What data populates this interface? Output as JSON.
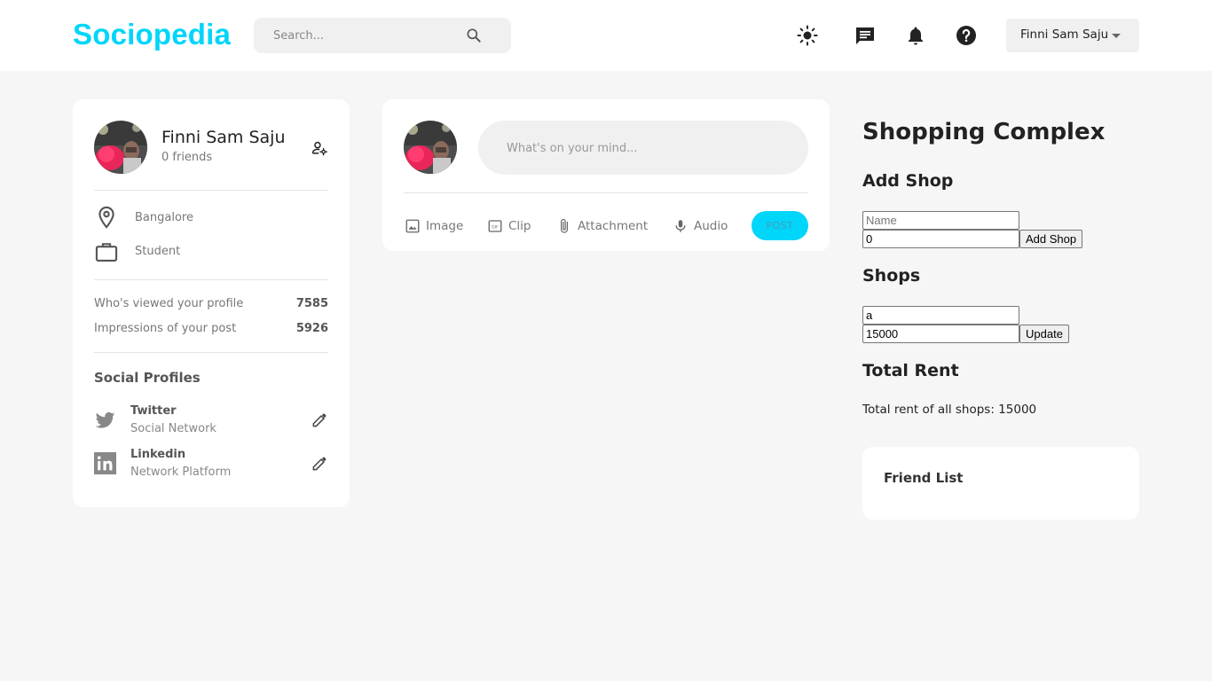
{
  "app": {
    "logo": "Sociopedia",
    "accent_color": "#00d5fa"
  },
  "navbar": {
    "search_placeholder": "Search...",
    "icons": [
      "light-mode-icon",
      "message-icon",
      "notification-icon",
      "help-icon"
    ],
    "user_select": {
      "selected": "Finni Sam Saju"
    }
  },
  "profile": {
    "name": "Finni Sam Saju",
    "friends": "0 friends",
    "location": "Bangalore",
    "occupation": "Student",
    "stats": [
      {
        "label": "Who's viewed your profile",
        "value": "7585"
      },
      {
        "label": "Impressions of your post",
        "value": "5926"
      }
    ],
    "social_title": "Social Profiles",
    "social": [
      {
        "name": "Twitter",
        "subtitle": "Social Network",
        "icon": "twitter-icon"
      },
      {
        "name": "Linkedin",
        "subtitle": "Network Platform",
        "icon": "linkedin-icon"
      }
    ]
  },
  "post": {
    "placeholder": "What's on your mind...",
    "actions": [
      {
        "label": "Image",
        "icon": "image-icon"
      },
      {
        "label": "Clip",
        "icon": "gif-icon"
      },
      {
        "label": "Attachment",
        "icon": "attachment-icon"
      },
      {
        "label": "Audio",
        "icon": "mic-icon"
      }
    ],
    "post_button": "POST"
  },
  "shopping": {
    "title": "Shopping Complex",
    "add_shop": {
      "heading": "Add Shop",
      "name_placeholder": "Name",
      "rent_value": "0",
      "button": "Add Shop"
    },
    "shops": {
      "heading": "Shops",
      "items": [
        {
          "name": "a",
          "rent": "15000",
          "button": "Update"
        }
      ]
    },
    "total": {
      "heading": "Total Rent",
      "text": "Total rent of all shops: 15000"
    }
  },
  "friend_list": {
    "title": "Friend List"
  }
}
